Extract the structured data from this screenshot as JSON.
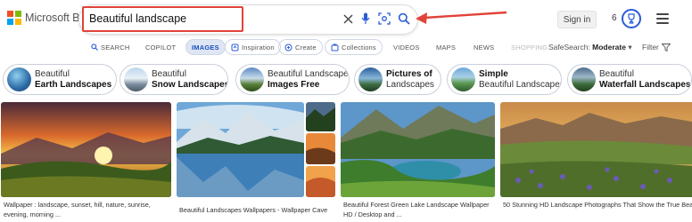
{
  "brand": {
    "name": "Microsoft Bing",
    "logo_colors": [
      "#f25022",
      "#7fba00",
      "#00a4ef",
      "#ffb900"
    ]
  },
  "search": {
    "query": "Beautiful landscape"
  },
  "icons": {
    "clear": "close-icon",
    "mic": "microphone-icon",
    "visual": "visual-search-icon",
    "search": "search-icon",
    "annotation": "red-arrow-icon"
  },
  "header": {
    "sign_in": "Sign in",
    "rewards_count": "6"
  },
  "nav": {
    "items": [
      {
        "label": "SEARCH",
        "icon": "search-icon"
      },
      {
        "label": "COPILOT"
      },
      {
        "label": "IMAGES"
      },
      {
        "label": "Inspiration",
        "icon": "inspiration-icon"
      },
      {
        "label": "Create",
        "icon": "create-icon"
      },
      {
        "label": "Collections",
        "icon": "collections-icon"
      },
      {
        "label": "VIDEOS"
      },
      {
        "label": "MAPS"
      },
      {
        "label": "NEWS"
      },
      {
        "label": "SHOPPING"
      }
    ],
    "safesearch_label": "SafeSearch:",
    "safesearch_value": "Moderate",
    "filter_label": "Filter"
  },
  "chips": [
    {
      "line1": "Beautiful",
      "line2": "Earth Landscapes"
    },
    {
      "line1": "Beautiful",
      "line2": "Snow Landscapes"
    },
    {
      "line1": "Beautiful Landscape",
      "line2": "Images Free"
    },
    {
      "line1": "Pictures of",
      "line2": "Landscapes"
    },
    {
      "line1": "Simple",
      "line2": "Beautiful Landscapes"
    },
    {
      "line1": "Beautiful",
      "line2": "Waterfall Landscapes"
    }
  ],
  "results": [
    {
      "caption": "Wallpaper : landscape, sunset, hill, nature, sunrise, evening, morning ..."
    },
    {
      "caption": "Beautiful Landscapes Wallpapers - Wallpaper Cave"
    },
    {
      "caption": "Beautiful Forest Green Lake Landscape Wallpaper HD / Desktop and ..."
    },
    {
      "caption": "50 Stunning HD Landscape Photographs That Show the True Beau"
    }
  ],
  "colors": {
    "annotation_red": "#e0433a",
    "accent_blue": "#1a4fbf",
    "pill_active_bg": "#dfe6f3"
  }
}
